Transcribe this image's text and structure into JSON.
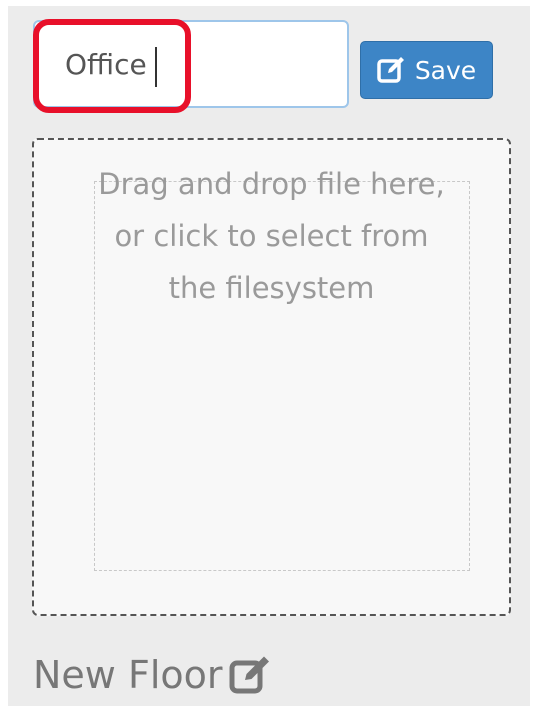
{
  "floor_form": {
    "name_input_value": "Office",
    "save_label": "Save",
    "save_icon": "edit-icon",
    "accent_color": "#3d85c6",
    "highlight_color": "#e8102a"
  },
  "dropzone": {
    "line1": "Drag and drop file here,",
    "line2": "or click to select from",
    "line3": "the filesystem"
  },
  "floor": {
    "title": "New Floor",
    "edit_icon": "edit-icon"
  }
}
